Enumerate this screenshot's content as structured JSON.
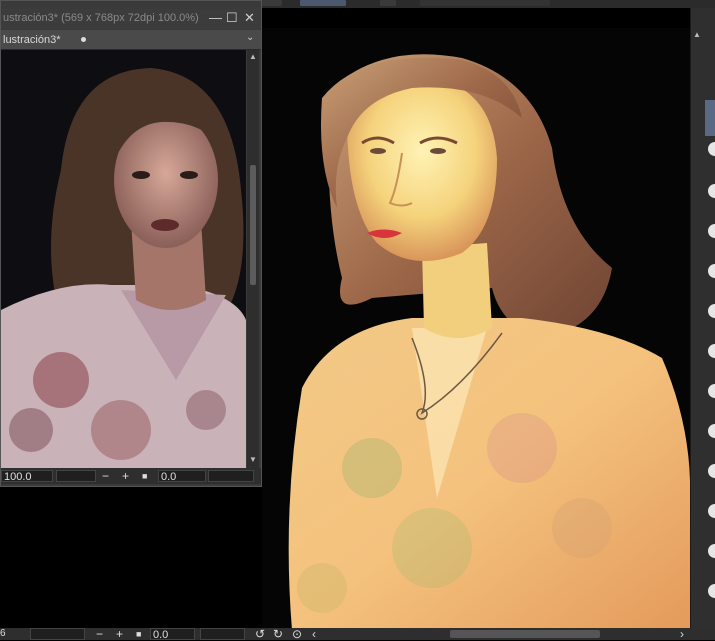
{
  "app": {
    "subwindow": {
      "title": "ustración3* (569 x 768px 72dpi 100.0%)",
      "tab_label": "lustración3*",
      "zoom_value": "100.0",
      "angle_value": "0.0",
      "minus_label": "−",
      "plus_label": "+",
      "reset_label": "■",
      "minimize_label": "—",
      "maximize_label": "☐",
      "close_label": "✕"
    },
    "main_status": {
      "zoom_value": "6",
      "angle_value": "0.0",
      "minus_label": "−",
      "plus_label": "+",
      "reset_label": "■"
    },
    "colors": {
      "panel_bg": "#3a3a3a",
      "canvas_bg": "#050505",
      "accent_tab": "#5a6a85"
    },
    "icons": [
      "minimize-icon",
      "maximize-icon",
      "close-icon",
      "chevron-down-icon",
      "scroll-up-icon",
      "scroll-down-icon",
      "rotate-left-icon",
      "rotate-right-icon",
      "flip-icon"
    ]
  }
}
